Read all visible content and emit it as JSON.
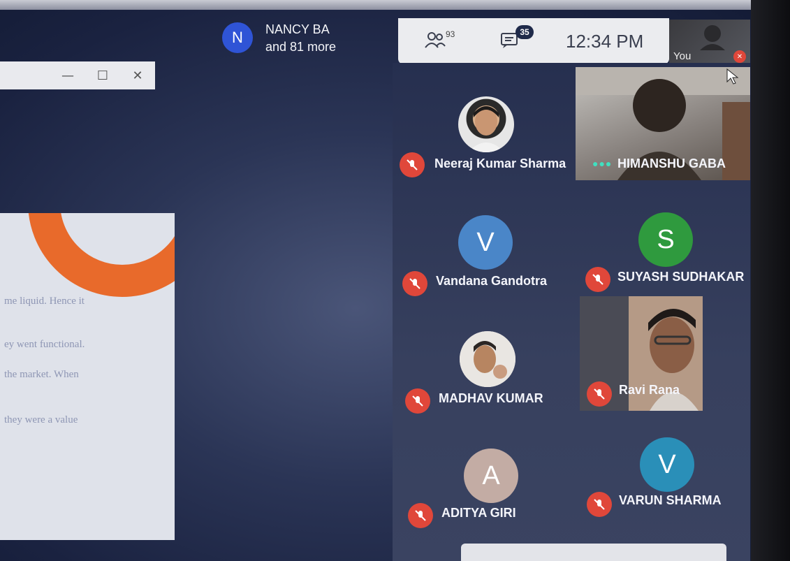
{
  "window_controls": {
    "minimize": "—",
    "maximize": "☐",
    "close": "✕"
  },
  "document": {
    "lines": [
      "me liquid. Hence it",
      "ey went functional.",
      "the market. When",
      "they were a value"
    ]
  },
  "host": {
    "initial": "N",
    "name": "NANCY BA",
    "more": "and 81 more"
  },
  "status": {
    "participants_count": "93",
    "chat_count": "35",
    "time": "12:34 PM"
  },
  "self": {
    "label": "You"
  },
  "participants": [
    {
      "name": "Neeraj Kumar Sharma",
      "type": "photo"
    },
    {
      "name": "HIMANSHU GABA",
      "type": "video"
    },
    {
      "name": "Vandana Gandotra",
      "initial": "V",
      "color": "#4a86c8"
    },
    {
      "name": "SUYASH SUDHAKAR",
      "initial": "S",
      "color": "#2f9a3e"
    },
    {
      "name": "MADHAV KUMAR",
      "type": "photo"
    },
    {
      "name": "Ravi Rana",
      "type": "video"
    },
    {
      "name": "ADITYA GIRI",
      "initial": "A",
      "color": "#c3aca4"
    },
    {
      "name": "VARUN SHARMA",
      "initial": "V",
      "color": "#2a8fb8"
    }
  ],
  "colors": {
    "mic_muted": "#e0473a",
    "accent_orange": "#e86a2b",
    "host_blue": "#2f54d6"
  }
}
